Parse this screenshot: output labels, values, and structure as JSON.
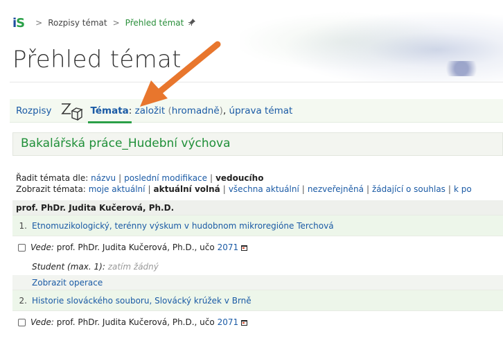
{
  "breadcrumb": {
    "logo_text": "IS",
    "sep": ">",
    "items": [
      "Rozpisy témat",
      "Přehled témat"
    ],
    "pin": "✱"
  },
  "page_title": "Přehled témat",
  "tabs": {
    "rozpisy": "Rozpisy",
    "temata_label": "Témata",
    "colon": ":",
    "zalozit": "založit",
    "hromadne_open": "(",
    "hromadne": "hromadně",
    "hromadne_close": ")",
    "comma": ",",
    "uprava": "úprava témat"
  },
  "section_title": "Bakalářská práce_Hudební výchova",
  "sort": {
    "prefix": "Řadit témata dle:",
    "options": [
      "názvu",
      "poslední modifikace",
      "vedoucího"
    ],
    "active": "vedoucího"
  },
  "show": {
    "prefix": "Zobrazit témata:",
    "options": [
      "moje aktuální",
      "aktuální volná",
      "všechna aktuální",
      "nezveřejněná",
      "žádající o souhlas",
      "k po"
    ],
    "active": "aktuální volná"
  },
  "table": {
    "group_head": "prof. PhDr. Judita Kučerová, Ph.D.",
    "topics": [
      {
        "num": "1.",
        "title": "Etnomuzikologický, terénny výskum v hudobnom mikroregióne Terchová",
        "vede_label": "Vede:",
        "vede_name": "prof. PhDr. Judita Kučerová, Ph.D., učo",
        "uco": "2071",
        "student_label": "Student (max. 1):",
        "student_value": "zatím žádný",
        "ops": "Zobrazit operace"
      },
      {
        "num": "2.",
        "title": "Historie slováckého souboru, Slovácký krúžek v Brně",
        "vede_label": "Vede:",
        "vede_name": "prof. PhDr. Judita Kučerová, Ph.D., učo",
        "uco": "2071"
      }
    ]
  },
  "colors": {
    "accent_green": "#2aa048",
    "link_blue": "#1a5aa5",
    "arrow_orange": "#e8762d"
  }
}
